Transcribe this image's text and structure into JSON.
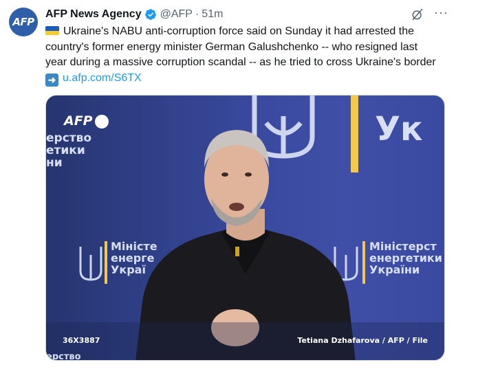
{
  "author": {
    "avatar_text": "AFP",
    "name": "AFP News Agency",
    "handle": "@AFP",
    "separator": "·",
    "time": "51m",
    "verified_icon": "verified-badge-icon",
    "brand_color": "#2f5fa8"
  },
  "header_icons": {
    "grok_icon": "grok-icon",
    "more_label": "···"
  },
  "tweet": {
    "flag": "ukraine-flag-emoji",
    "body": "Ukraine's NABU anti-corruption force said on Sunday it had arrested the country's former energy minister German Galushchenko -- who resigned last year during a massive corruption scandal -- as he tried to cross Ukraine's border",
    "arrow_icon": "right-arrow-emoji",
    "arrow_glyph": "➜",
    "link": "u.afp.com/S6TX",
    "link_color": "#1d9bf0"
  },
  "media": {
    "logo_text": "AFP",
    "wall_left_lines": [
      "ерство",
      "етики",
      "ни"
    ],
    "wall_right_big": "Ук",
    "wall_sign_left": [
      "Міністе",
      "енерге",
      "Украї"
    ],
    "wall_sign_right": [
      "Міністерст",
      "енергетики",
      "України"
    ],
    "wall_bottom_left": "ерство",
    "photo_id": "36X3887",
    "credit": "Tetiana Dzhafarova / AFP / File"
  }
}
